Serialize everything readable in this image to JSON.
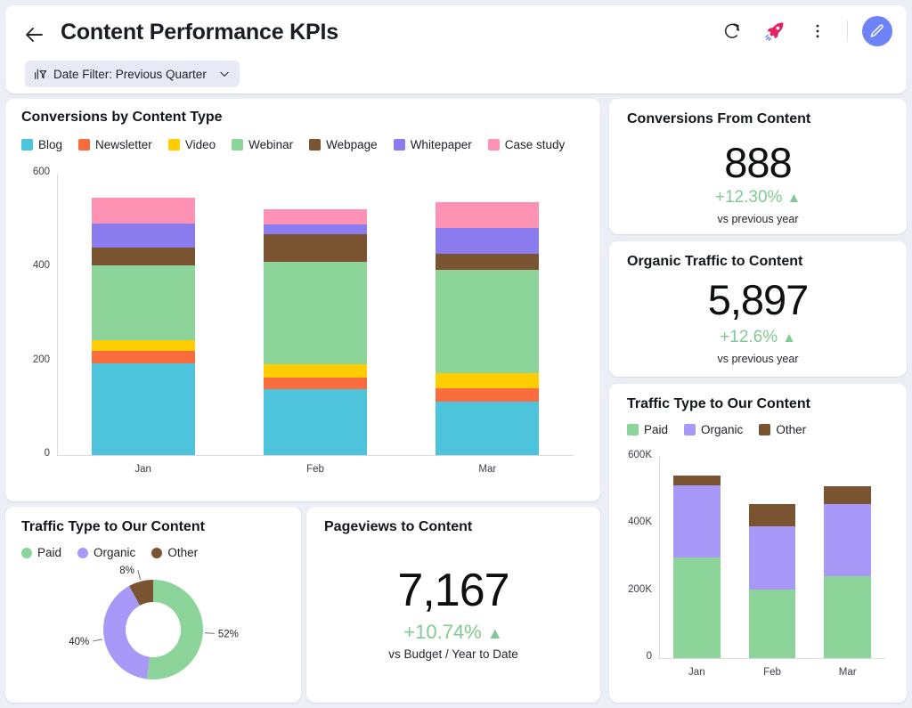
{
  "header": {
    "title": "Content Performance KPIs",
    "back_icon": "arrow-left-icon",
    "refresh_icon": "refresh-icon",
    "rocket_icon": "rocket-icon",
    "more_icon": "more-vertical-icon",
    "edit_icon": "pencil-icon",
    "filter": {
      "icon": "chart-filter-icon",
      "label": "Date Filter: Previous Quarter",
      "chevron": "chevron-down-icon"
    }
  },
  "colors": {
    "page_bg": "#eceef6",
    "accent": "#6e83f7",
    "positive": "#82c995",
    "blog": "#4ec3dc",
    "newsletter": "#f96c3d",
    "video": "#ffcd00",
    "webinar": "#8cd49a",
    "webpage": "#7a5430",
    "whitepaper": "#8a7bef",
    "case_study": "#fe92b4",
    "rocket": "#e61e64"
  },
  "conversions_chart": {
    "title": "Conversions by Content Type"
  },
  "kpi_conversions": {
    "title": "Conversions From Content",
    "value": "888",
    "delta": "+12.30%",
    "delta_arrow": "▲",
    "subtitle": "vs previous year"
  },
  "kpi_organic": {
    "title": "Organic Traffic to Content",
    "value": "5,897",
    "delta": "+12.6%",
    "delta_arrow": "▲",
    "subtitle": "vs previous year"
  },
  "kpi_pageviews": {
    "title": "Pageviews to Content",
    "value": "7,167",
    "delta": "+10.74%",
    "delta_arrow": "▲",
    "subtitle": "vs Budget / Year to Date"
  },
  "traffic_bar": {
    "title": "Traffic Type to Our Content"
  },
  "traffic_donut": {
    "title": "Traffic Type to Our Content"
  },
  "chart_data": [
    {
      "id": "conversions_by_content_type",
      "type": "bar",
      "stacked": true,
      "title": "Conversions by Content Type",
      "xlabel": "",
      "ylabel": "",
      "categories": [
        "Jan",
        "Feb",
        "Mar"
      ],
      "ylim": [
        0,
        600
      ],
      "yticks": [
        0,
        200,
        400,
        600
      ],
      "ytick_labels": [
        "0",
        "200",
        "400",
        "600"
      ],
      "grid": false,
      "legend_position": "top-left",
      "series": [
        {
          "name": "Blog",
          "color": "#4ec3dc",
          "values": [
            196,
            140,
            114
          ]
        },
        {
          "name": "Newsletter",
          "color": "#f96c3d",
          "values": [
            26,
            26,
            28
          ]
        },
        {
          "name": "Video",
          "color": "#ffcd00",
          "values": [
            22,
            28,
            33
          ]
        },
        {
          "name": "Webinar",
          "color": "#8cd49a",
          "values": [
            161,
            218,
            220
          ]
        },
        {
          "name": "Webpage",
          "color": "#7a5430",
          "values": [
            37,
            59,
            35
          ]
        },
        {
          "name": "Whitepaper",
          "color": "#8a7bef",
          "values": [
            52,
            20,
            55
          ]
        },
        {
          "name": "Case study",
          "color": "#fe92b4",
          "values": [
            55,
            33,
            55
          ]
        }
      ],
      "totals": [
        549,
        524,
        540
      ]
    },
    {
      "id": "traffic_type_bar",
      "type": "bar",
      "stacked": true,
      "title": "Traffic Type to Our Content",
      "categories": [
        "Jan",
        "Feb",
        "Mar"
      ],
      "ylim": [
        0,
        600000
      ],
      "yticks": [
        0,
        200000,
        400000,
        600000
      ],
      "ytick_labels": [
        "0",
        "200K",
        "400K",
        "600K"
      ],
      "grid": false,
      "legend_position": "top-left",
      "series": [
        {
          "name": "Paid",
          "color": "#8cd49a",
          "values": [
            300000,
            205000,
            243000
          ]
        },
        {
          "name": "Organic",
          "color": "#a898f7",
          "values": [
            215000,
            188000,
            215000
          ]
        },
        {
          "name": "Other",
          "color": "#7a5430",
          "values": [
            30000,
            67000,
            54000
          ]
        }
      ],
      "totals": [
        545000,
        460000,
        512000
      ]
    },
    {
      "id": "traffic_type_donut",
      "type": "pie",
      "donut": true,
      "title": "Traffic Type to Our Content",
      "labels": [
        "Paid",
        "Organic",
        "Other"
      ],
      "values": [
        52,
        40,
        8
      ],
      "value_labels": [
        "52%",
        "40%",
        "8%"
      ],
      "colors": [
        "#8cd49a",
        "#a898f7",
        "#7a5430"
      ],
      "legend_position": "top-left"
    }
  ]
}
